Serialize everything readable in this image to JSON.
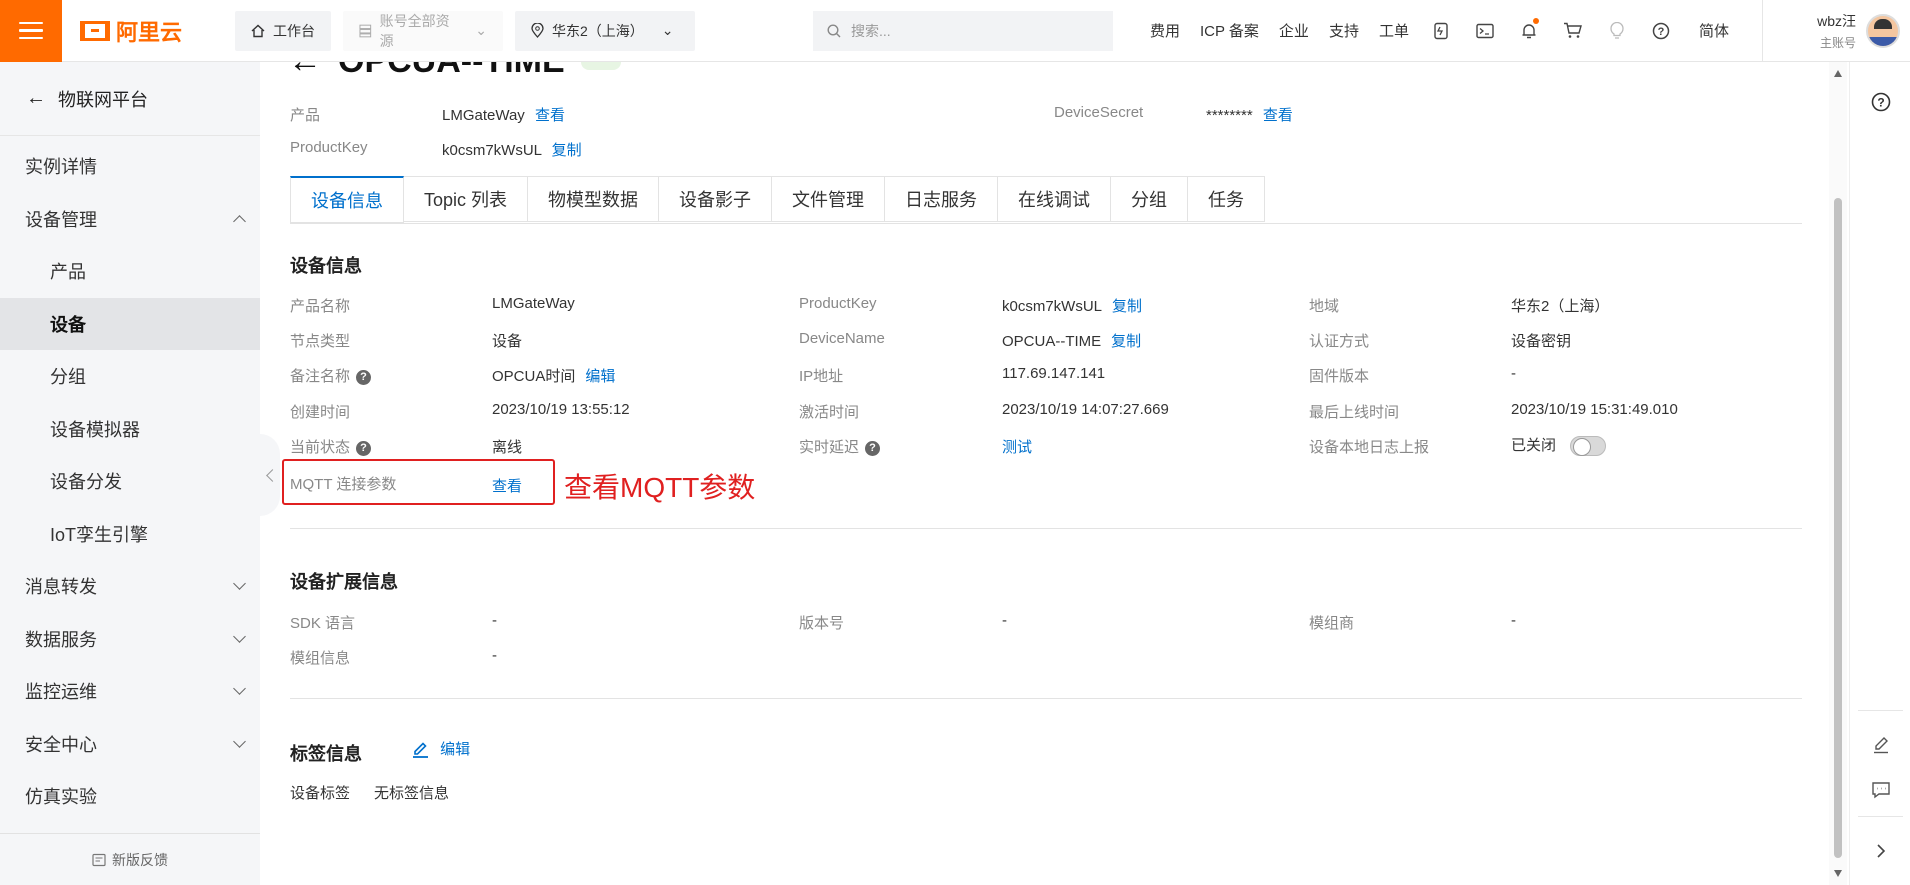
{
  "topbar": {
    "logo_text": "阿里云",
    "workbench": "工作台",
    "resource_scope": "账号全部资源",
    "region": "华东2（上海）",
    "search_placeholder": "搜索...",
    "links": [
      "费用",
      "ICP 备案",
      "企业",
      "支持",
      "工单"
    ],
    "lang": "简体",
    "user_name": "wbz汪",
    "user_role": "主账号",
    "accent": "#ff6a00"
  },
  "sidebar": {
    "back_label": "物联网平台",
    "items": [
      {
        "label": "实例详情",
        "level": 1,
        "chevron": ""
      },
      {
        "label": "设备管理",
        "level": 1,
        "chevron": "up"
      },
      {
        "label": "产品",
        "level": 2,
        "chevron": ""
      },
      {
        "label": "设备",
        "level": 2,
        "chevron": "",
        "active": true
      },
      {
        "label": "分组",
        "level": 2,
        "chevron": ""
      },
      {
        "label": "设备模拟器",
        "level": 2,
        "chevron": ""
      },
      {
        "label": "设备分发",
        "level": 2,
        "chevron": ""
      },
      {
        "label": "IoT孪生引擎",
        "level": 2,
        "chevron": ""
      },
      {
        "label": "消息转发",
        "level": 1,
        "chevron": "down"
      },
      {
        "label": "数据服务",
        "level": 1,
        "chevron": "down"
      },
      {
        "label": "监控运维",
        "level": 1,
        "chevron": "down"
      },
      {
        "label": "安全中心",
        "level": 1,
        "chevron": "down"
      },
      {
        "label": "仿真实验",
        "level": 1,
        "chevron": ""
      }
    ],
    "feedback": "新版反馈"
  },
  "header": {
    "device_title": "OPCUA--TIME",
    "product_label": "产品",
    "product_value": "LMGateWay",
    "product_link": "查看",
    "productkey_label": "ProductKey",
    "productkey_value": "k0csm7kWsUL",
    "productkey_link": "复制",
    "secret_label": "DeviceSecret",
    "secret_value": "********",
    "secret_link": "查看"
  },
  "tabs": [
    "设备信息",
    "Topic 列表",
    "物模型数据",
    "设备影子",
    "文件管理",
    "日志服务",
    "在线调试",
    "分组",
    "任务"
  ],
  "device_info": {
    "title": "设备信息",
    "product_name_label": "产品名称",
    "product_name_value": "LMGateWay",
    "pk_label": "ProductKey",
    "pk_value": "k0csm7kWsUL",
    "pk_link": "复制",
    "region_label": "地域",
    "region_value": "华东2（上海）",
    "node_type_label": "节点类型",
    "node_type_value": "设备",
    "device_name_label": "DeviceName",
    "device_name_value": "OPCUA--TIME",
    "device_name_link": "复制",
    "auth_label": "认证方式",
    "auth_value": "设备密钥",
    "alias_label": "备注名称",
    "alias_value": "OPCUA时间",
    "alias_link": "编辑",
    "ip_label": "IP地址",
    "ip_value": "117.69.147.141",
    "fw_label": "固件版本",
    "fw_value": "-",
    "created_label": "创建时间",
    "created_value": "2023/10/19 13:55:12",
    "activated_label": "激活时间",
    "activated_value": "2023/10/19 14:07:27.669",
    "last_online_label": "最后上线时间",
    "last_online_value": "2023/10/19 15:31:49.010",
    "status_label": "当前状态",
    "status_value": "离线",
    "latency_label": "实时延迟",
    "latency_link": "测试",
    "local_log_label": "设备本地日志上报",
    "local_log_value": "已关闭",
    "mqtt_label": "MQTT 连接参数",
    "mqtt_link": "查看",
    "annotation": "查看MQTT参数"
  },
  "ext_info": {
    "title": "设备扩展信息",
    "sdk_label": "SDK 语言",
    "sdk_value": "-",
    "version_label": "版本号",
    "version_value": "-",
    "vendor_label": "模组商",
    "vendor_value": "-",
    "module_label": "模组信息",
    "module_value": "-"
  },
  "tag_info": {
    "title": "标签信息",
    "edit_link": "编辑",
    "tag_label": "设备标签",
    "tag_value": "无标签信息"
  }
}
